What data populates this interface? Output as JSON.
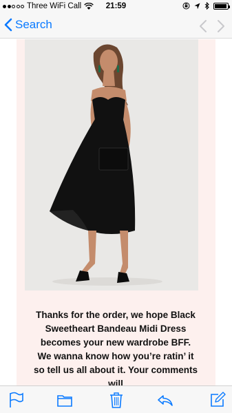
{
  "status_bar": {
    "carrier": "Three WiFi Call",
    "time": "21:59",
    "battery_level": 0.85
  },
  "nav": {
    "back_label": "Search"
  },
  "email": {
    "message": "Thanks for the order, we hope Black Sweetheart Bandeau Midi Dress becomes your new wardrobe BFF. We wanna know how you’re ratin’ it so tell us all about it. Your comments will"
  },
  "toolbar": {
    "icons": [
      "flag-icon",
      "folder-icon",
      "trash-icon",
      "reply-icon",
      "compose-icon"
    ]
  },
  "colors": {
    "accent": "#0a7aff",
    "card_background": "#fdf0ee",
    "dress": "#111111"
  }
}
